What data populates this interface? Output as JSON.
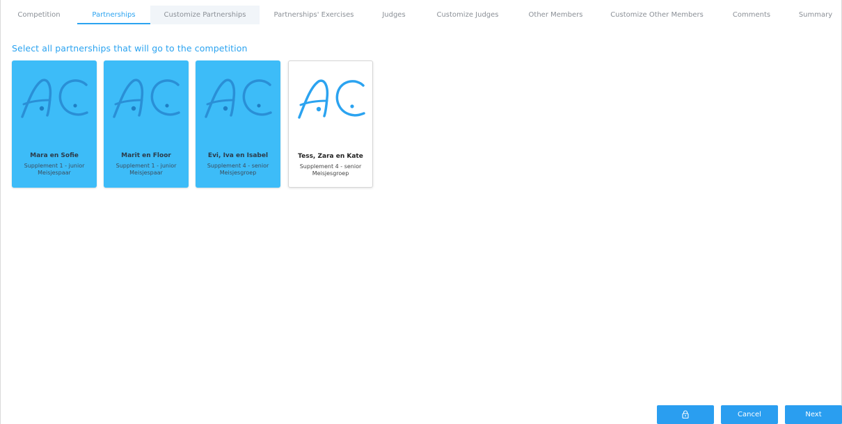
{
  "tabs": [
    {
      "label": "Competition"
    },
    {
      "label": "Partnerships"
    },
    {
      "label": "Customize Partnerships"
    },
    {
      "label": "Partnerships' Exercises"
    },
    {
      "label": "Judges"
    },
    {
      "label": "Customize Judges"
    },
    {
      "label": "Other Members"
    },
    {
      "label": "Customize Other Members"
    },
    {
      "label": "Comments"
    },
    {
      "label": "Summary"
    }
  ],
  "active_tab": "Partnerships",
  "heading": "Select all partnerships that will go to the competition",
  "logo_text": "AC",
  "partnerships": [
    {
      "name": "Mara en Sofie",
      "description": "Supplement 1 - junior Meisjespaar",
      "selected": true
    },
    {
      "name": "Marit en Floor",
      "description": "Supplement 1 - junior Meisjespaar",
      "selected": true
    },
    {
      "name": "Evi, Iva en Isabel",
      "description": "Supplement 4 - senior Meisjesgroep",
      "selected": true
    },
    {
      "name": "Tess, Zara en Kate",
      "description": "Supplement 4 - senior Meisjesgroep",
      "selected": false
    }
  ],
  "footer": {
    "lock_icon": "lock-icon",
    "cancel_label": "Cancel",
    "next_label": "Next"
  },
  "colors": {
    "accent": "#2ba3f0",
    "card_selected": "#3dbcf8",
    "button": "#2a9ef0"
  }
}
